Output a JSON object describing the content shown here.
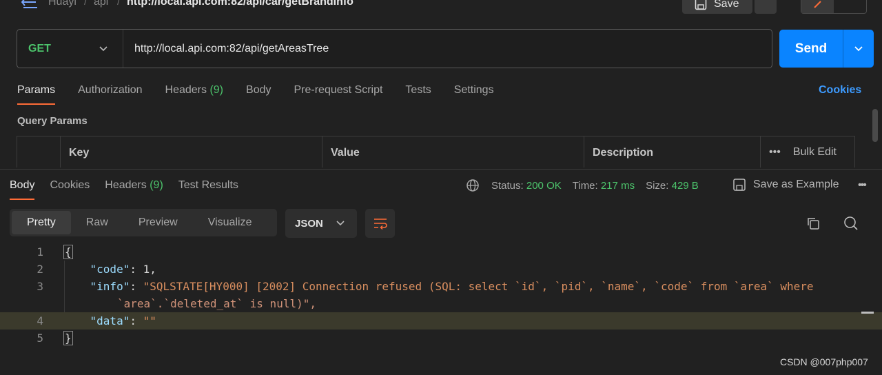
{
  "breadcrumb": {
    "part1": "Huayi",
    "sep": "/",
    "part2": "api",
    "current": "http://local.api.com:82/api/car/getBrandInfo"
  },
  "toolbar": {
    "save_label": "Save"
  },
  "request": {
    "method": "GET",
    "url": "http://local.api.com:82/api/getAreasTree",
    "send_label": "Send"
  },
  "request_tabs": [
    {
      "label": "Params",
      "count": ""
    },
    {
      "label": "Authorization",
      "count": ""
    },
    {
      "label": "Headers",
      "count": "(9)"
    },
    {
      "label": "Body",
      "count": ""
    },
    {
      "label": "Pre-request Script",
      "count": ""
    },
    {
      "label": "Tests",
      "count": ""
    },
    {
      "label": "Settings",
      "count": ""
    }
  ],
  "cookies_link": "Cookies",
  "query_params": {
    "title": "Query Params",
    "columns": [
      "Key",
      "Value",
      "Description"
    ],
    "bulk_edit": "Bulk Edit",
    "more": "•••"
  },
  "response_tabs": [
    {
      "label": "Body",
      "count": ""
    },
    {
      "label": "Cookies",
      "count": ""
    },
    {
      "label": "Headers",
      "count": "(9)"
    },
    {
      "label": "Test Results",
      "count": ""
    }
  ],
  "status": {
    "status_label": "Status:",
    "status_value": "200 OK",
    "time_label": "Time:",
    "time_value": "217 ms",
    "size_label": "Size:",
    "size_value": "429 B"
  },
  "save_as_example": "Save as Example",
  "more_dots": "•••",
  "view_modes": [
    "Pretty",
    "Raw",
    "Preview",
    "Visualize"
  ],
  "format": "JSON",
  "code": {
    "line_numbers": [
      "1",
      "2",
      "3",
      "4",
      "5"
    ],
    "open_brace": "{",
    "close_brace": "}",
    "code_key": "\"code\"",
    "code_val": "1,",
    "info_key": "\"info\"",
    "info_val_1": "\"SQLSTATE[HY000] [2002] Connection refused (SQL: select `id`, `pid`, `name`, `code` from `area` where",
    "info_val_2": "`area`.`deleted_at` is null)\",",
    "data_key": "\"data\"",
    "data_val": "\"\""
  },
  "watermark": "CSDN @007php007",
  "colors": {
    "accent": "#ff6c37",
    "send": "#0a84ff",
    "success": "#4cc36b",
    "link": "#3d9bff"
  }
}
